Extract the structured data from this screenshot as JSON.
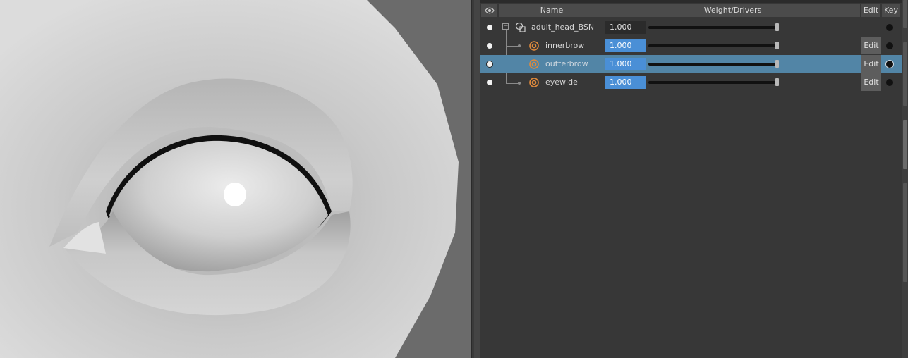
{
  "columns": {
    "name": "Name",
    "weight": "Weight/Drivers",
    "edit": "Edit",
    "key": "Key"
  },
  "rows": [
    {
      "name": "adult_head_BSN",
      "weight": "1.000",
      "edit_label": "",
      "selected": false,
      "level": 0,
      "icon": "blendshape-node-icon"
    },
    {
      "name": "innerbrow",
      "weight": "1.000",
      "edit_label": "Edit",
      "selected": false,
      "level": 1,
      "icon": "target-icon"
    },
    {
      "name": "outterbrow",
      "weight": "1.000",
      "edit_label": "Edit",
      "selected": true,
      "level": 1,
      "icon": "target-icon"
    },
    {
      "name": "eyewide",
      "weight": "1.000",
      "edit_label": "Edit",
      "selected": false,
      "level": 1,
      "icon": "target-icon"
    }
  ],
  "sliders": [
    1.0,
    1.0,
    1.0,
    1.0
  ],
  "colors": {
    "selected_row": "#5285a6",
    "weight_field_active": "#4a8fd6",
    "target_icon": "#e08a3c"
  }
}
